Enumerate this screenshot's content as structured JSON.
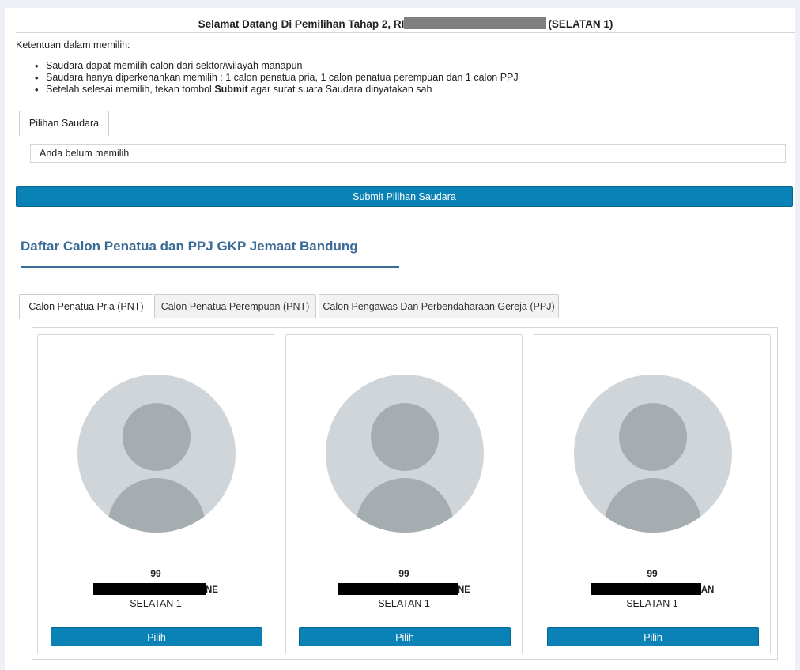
{
  "header": {
    "title_prefix": "Selamat Datang Di Pemilihan Tahap 2, RI",
    "title_suffix": "(SELATAN 1)"
  },
  "rules": {
    "heading": "Ketentuan dalam memilih:",
    "items": [
      {
        "text": "Saudara dapat memilih calon dari sektor/wilayah manapun"
      },
      {
        "text": "Saudara hanya diperkenankan memilih : 1 calon penatua pria, 1 calon penatua perempuan dan 1 calon PPJ"
      },
      {
        "pre": "Setelah selesai memilih, tekan tombol ",
        "bold": "Submit",
        "post": " agar surat suara Saudara dinyatakan sah"
      }
    ]
  },
  "selection": {
    "tab_label": "Pilihan Saudara",
    "current_value": "Anda belum memilih"
  },
  "submit_label": "Submit Pilihan Saudara",
  "section": {
    "title": "Daftar Calon Penatua dan PPJ GKP Jemaat Bandung"
  },
  "tabs": [
    {
      "label": "Calon Penatua Pria (PNT)",
      "active": true
    },
    {
      "label": "Calon Penatua Perempuan (PNT)",
      "active": false
    },
    {
      "label": "Calon Pengawas Dan Perbendaharaan Gereja (PPJ)",
      "active": false
    }
  ],
  "candidates": [
    {
      "number": "99",
      "name_suffix": "NE",
      "area": "SELATAN 1",
      "button": "Pilih"
    },
    {
      "number": "99",
      "name_suffix": "NE",
      "area": "SELATAN 1",
      "button": "Pilih"
    },
    {
      "number": "99",
      "name_suffix": "AN",
      "area": "SELATAN 1",
      "button": "Pilih"
    }
  ],
  "colors": {
    "primary": "#0a82b6",
    "section_title": "#3a6a96",
    "avatar_bg": "#cfd5d9",
    "avatar_fg": "#a6adb0"
  }
}
